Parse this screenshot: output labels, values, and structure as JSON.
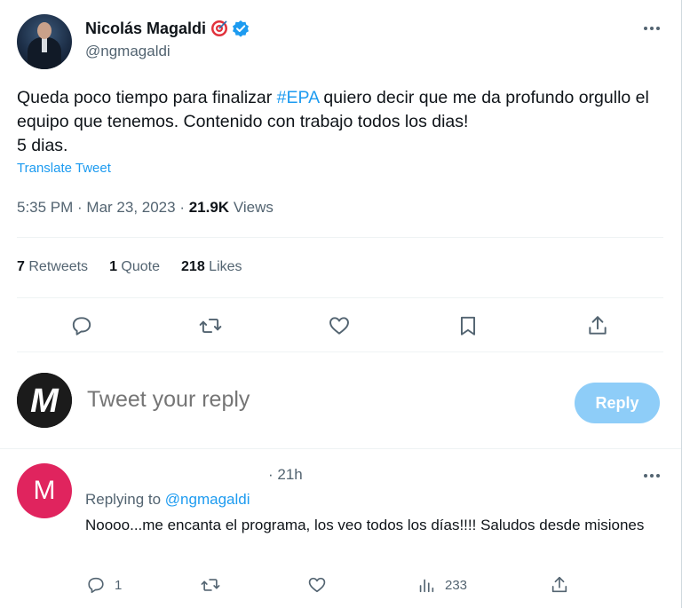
{
  "tweet": {
    "author_name": "Nicolás Magaldi",
    "handle": "@ngmagaldi",
    "text_before": "Queda poco tiempo para finalizar ",
    "hashtag": "#EPA",
    "text_after": " quiero decir que me da profundo orgullo el equipo que tenemos.  Contenido con trabajo todos los dias!",
    "text_line3": "5 dias.",
    "translate_label": "Translate Tweet",
    "time": "5:35 PM",
    "date": "Mar 23, 2023",
    "views_count": "21.9K",
    "views_label": "Views",
    "retweets_count": "7",
    "retweets_label": "Retweets",
    "quotes_count": "1",
    "quotes_label": "Quote",
    "likes_count": "218",
    "likes_label": "Likes"
  },
  "composer": {
    "placeholder": "Tweet your reply",
    "reply_button": "Reply",
    "avatar_letter": "M"
  },
  "reply": {
    "avatar_letter": "M",
    "time": "· 21h",
    "replying_prefix": "Replying to ",
    "replying_to": "@ngmagaldi",
    "text": "Noooo...me encanta el programa, los veo todos los días!!!! Saludos desde misiones",
    "reply_count": "1",
    "views_count": "233"
  },
  "colors": {
    "accent": "#1d9bf0",
    "reply_button_disabled": "#8ecdf8",
    "reply_avatar": "#e0245e",
    "secondary_text": "#536471"
  },
  "icons": {
    "reply": "reply-icon",
    "retweet": "retweet-icon",
    "like": "heart-icon",
    "bookmark": "bookmark-icon",
    "share": "share-icon",
    "views": "views-icon",
    "verified": "verified-badge-icon",
    "target_emoji": "target-emoji-icon",
    "more": "more-icon"
  }
}
